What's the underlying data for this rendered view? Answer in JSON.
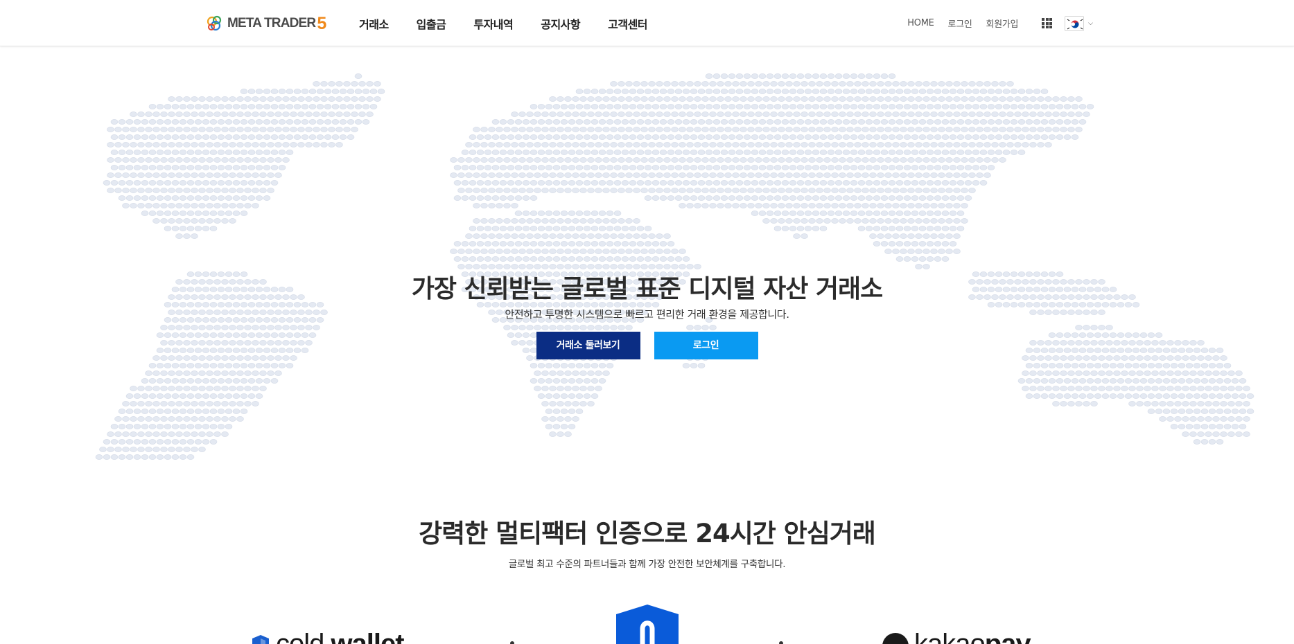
{
  "header": {
    "logo_text": "META TRADER",
    "logo_number": "5",
    "nav": [
      {
        "label": "거래소"
      },
      {
        "label": "입출금"
      },
      {
        "label": "투자내역"
      },
      {
        "label": "공지사항"
      },
      {
        "label": "고객센터"
      }
    ],
    "util": {
      "home": "HOME",
      "login": "로그인",
      "signup": "회원가입"
    },
    "language_icon": "korea-flag-icon"
  },
  "hero": {
    "title": "가장 신뢰받는 글로벌 표준 디지털 자산 거래소",
    "subtitle": "안전하고 투명한 시스템으로 빠르고 편리한 거래 환경을 제공합니다.",
    "primary_button": "거래소 둘러보기",
    "secondary_button": "로그인",
    "colors": {
      "primary": "#0b2d84",
      "secondary": "#0a9af2",
      "map_dot": "#e4e9f2"
    }
  },
  "security": {
    "title": "강력한 멀티팩터 인증으로 24시간 안심거래",
    "subtitle": "글로벌 최고 수준의 파트너들과 함께 가장 안전한 보안체계를 구축합니다.",
    "partners": {
      "cold_wallet_a": "cold",
      "cold_wallet_b": "wallet",
      "kakao_a": "kakao",
      "kakao_b": "pay"
    },
    "lock_color": "#0a5bd9"
  }
}
